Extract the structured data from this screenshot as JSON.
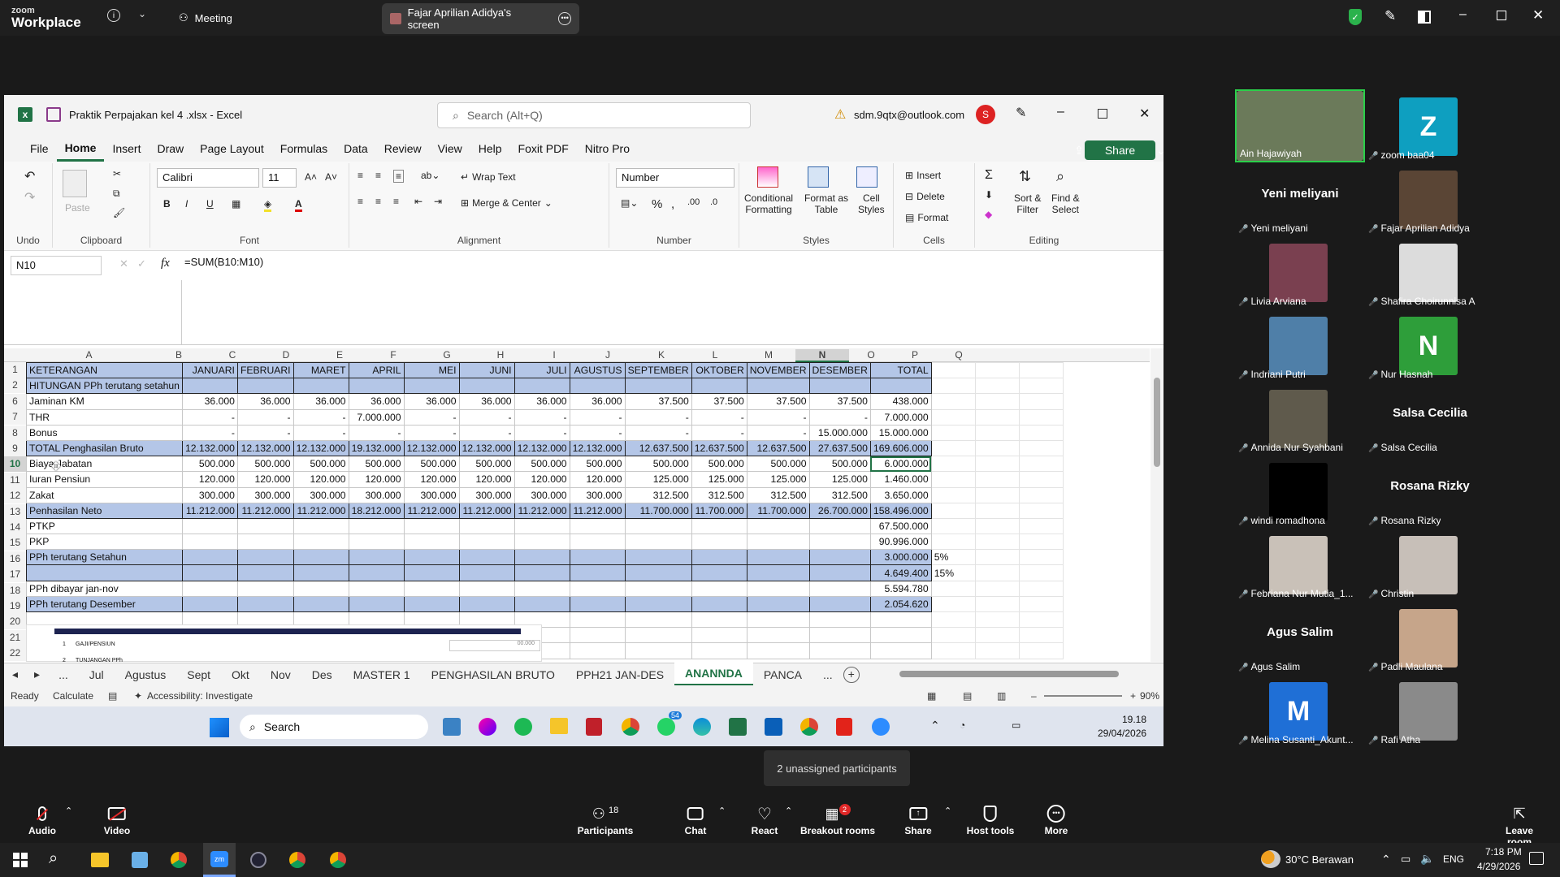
{
  "zoom": {
    "brand_top": "zoom",
    "brand_bottom": "Workplace",
    "tab_meeting": "Meeting",
    "tab_share": "Fajar Aprilian Adidya's screen"
  },
  "excel": {
    "title": "Praktik Perpajakan kel 4 .xlsx - Excel",
    "search_placeholder": "Search (Alt+Q)",
    "account": "sdm.9qtx@outlook.com",
    "avatar": "S",
    "menu": [
      "File",
      "Home",
      "Insert",
      "Draw",
      "Page Layout",
      "Formulas",
      "Data",
      "Review",
      "View",
      "Help",
      "Foxit PDF",
      "Nitro Pro"
    ],
    "share": "Share",
    "ribbon": {
      "undo": "Undo",
      "clipboard": "Clipboard",
      "paste": "Paste",
      "font": "Font",
      "font_name": "Calibri",
      "font_size": "11",
      "alignment": "Alignment",
      "wrap_text": "Wrap Text",
      "merge_center": "Merge & Center",
      "number": "Number",
      "number_format": "Number",
      "styles": "Styles",
      "cond_fmt_1": "Conditional",
      "cond_fmt_2": "Formatting",
      "fmt_table_1": "Format as",
      "fmt_table_2": "Table",
      "cell_styles_1": "Cell",
      "cell_styles_2": "Styles",
      "cells": "Cells",
      "insert": "Insert",
      "delete": "Delete",
      "format": "Format",
      "editing": "Editing",
      "sort_1": "Sort &",
      "sort_2": "Filter",
      "find_1": "Find &",
      "find_2": "Select"
    },
    "name_box": "N10",
    "formula": "=SUM(B10:M10)",
    "col_headers": [
      "A",
      "B",
      "C",
      "D",
      "E",
      "F",
      "G",
      "H",
      "I",
      "J",
      "K",
      "L",
      "M",
      "N",
      "O",
      "P",
      "Q"
    ],
    "row_numbers": [
      "1",
      "2",
      "6",
      "7",
      "8",
      "9",
      "10",
      "11",
      "12",
      "13",
      "14",
      "15",
      "16",
      "17",
      "18",
      "19",
      "20",
      "21",
      "22"
    ],
    "rows": [
      [
        "KETERANGAN",
        "JANUARI",
        "FEBRUARI",
        "MARET",
        "APRIL",
        "MEI",
        "JUNI",
        "JULI",
        "AGUSTUS",
        "SEPTEMBER",
        "OKTOBER",
        "NOVEMBER",
        "DESEMBER",
        "TOTAL",
        "",
        ""
      ],
      [
        "HITUNGAN PPh terutang setahun",
        "",
        "",
        "",
        "",
        "",
        "",
        "",
        "",
        "",
        "",
        "",
        "",
        "",
        "",
        ""
      ],
      [
        "Jaminan KM",
        "36.000",
        "36.000",
        "36.000",
        "36.000",
        "36.000",
        "36.000",
        "36.000",
        "36.000",
        "37.500",
        "37.500",
        "37.500",
        "37.500",
        "438.000",
        "",
        ""
      ],
      [
        "THR",
        "-",
        "-",
        "-",
        "7.000.000",
        "-",
        "-",
        "-",
        "-",
        "-",
        "-",
        "-",
        "-",
        "7.000.000",
        "",
        ""
      ],
      [
        "Bonus",
        "-",
        "-",
        "-",
        "-",
        "-",
        "-",
        "-",
        "-",
        "-",
        "-",
        "-",
        "15.000.000",
        "15.000.000",
        "",
        ""
      ],
      [
        "TOTAL Penghasilan Bruto",
        "12.132.000",
        "12.132.000",
        "12.132.000",
        "19.132.000",
        "12.132.000",
        "12.132.000",
        "12.132.000",
        "12.132.000",
        "12.637.500",
        "12.637.500",
        "12.637.500",
        "27.637.500",
        "169.606.000",
        "",
        ""
      ],
      [
        "Biaya Jabatan",
        "500.000",
        "500.000",
        "500.000",
        "500.000",
        "500.000",
        "500.000",
        "500.000",
        "500.000",
        "500.000",
        "500.000",
        "500.000",
        "500.000",
        "6.000.000",
        "",
        ""
      ],
      [
        "Iuran Pensiun",
        "120.000",
        "120.000",
        "120.000",
        "120.000",
        "120.000",
        "120.000",
        "120.000",
        "120.000",
        "125.000",
        "125.000",
        "125.000",
        "125.000",
        "1.460.000",
        "",
        ""
      ],
      [
        "Zakat",
        "300.000",
        "300.000",
        "300.000",
        "300.000",
        "300.000",
        "300.000",
        "300.000",
        "300.000",
        "312.500",
        "312.500",
        "312.500",
        "312.500",
        "3.650.000",
        "",
        ""
      ],
      [
        "Penhasilan Neto",
        "11.212.000",
        "11.212.000",
        "11.212.000",
        "18.212.000",
        "11.212.000",
        "11.212.000",
        "11.212.000",
        "11.212.000",
        "11.700.000",
        "11.700.000",
        "11.700.000",
        "26.700.000",
        "158.496.000",
        "",
        ""
      ],
      [
        "PTKP",
        "",
        "",
        "",
        "",
        "",
        "",
        "",
        "",
        "",
        "",
        "",
        "",
        "67.500.000",
        "",
        ""
      ],
      [
        "PKP",
        "",
        "",
        "",
        "",
        "",
        "",
        "",
        "",
        "",
        "",
        "",
        "",
        "90.996.000",
        "",
        ""
      ],
      [
        "PPh terutang Setahun",
        "",
        "",
        "",
        "",
        "",
        "",
        "",
        "",
        "",
        "",
        "",
        "",
        "3.000.000",
        "5%",
        ""
      ],
      [
        "",
        "",
        "",
        "",
        "",
        "",
        "",
        "",
        "",
        "",
        "",
        "",
        "",
        "4.649.400",
        "15%",
        ""
      ],
      [
        "PPh dibayar jan-nov",
        "",
        "",
        "",
        "",
        "",
        "",
        "",
        "",
        "",
        "",
        "",
        "",
        "5.594.780",
        "",
        ""
      ],
      [
        "PPh terutang Desember",
        "",
        "",
        "",
        "",
        "",
        "",
        "",
        "",
        "",
        "",
        "",
        "",
        "2.054.620",
        "",
        ""
      ]
    ],
    "embedded": {
      "line1": "1",
      "line1_text": "GAJI/PENSIUN",
      "line2": "2",
      "line2_text": "TUNJANGAN PPh",
      "amount": "00.000"
    },
    "sheet_tabs": [
      "...",
      "Jul",
      "Agustus",
      "Sept",
      "Okt",
      "Nov",
      "Des",
      "MASTER 1",
      "PENGHASILAN BRUTO",
      "PPH21 JAN-DES",
      "ANANNDA",
      "PANCA",
      "..."
    ],
    "status_ready": "Ready",
    "status_calc": "Calculate",
    "status_access": "Accessibility: Investigate",
    "zoom_level": "90%",
    "win_search": "Search",
    "win_time": "19.18",
    "win_date": "29/04/2026",
    "badge_count": "54"
  },
  "participants": [
    {
      "name": "Ain Hajawiyah",
      "initial": "",
      "bg": "#6b7a5a"
    },
    {
      "name": "zoom baa04",
      "initial": "Z",
      "bg": "#0e9fc0"
    },
    {
      "name": "Yeni meliyani",
      "label": "Yeni meliyani"
    },
    {
      "name": "Fajar Aprilian Adidya",
      "initial": "",
      "bg": "#5a4535"
    },
    {
      "name": "Livia Arviana",
      "initial": "",
      "bg": "#7a4050"
    },
    {
      "name": "Shafira Choirunnisa A",
      "initial": "",
      "bg": "#dcdcdc"
    },
    {
      "name": "Indriani Putri",
      "initial": "",
      "bg": "#4f7fa8"
    },
    {
      "name": "Nur Hasnah",
      "initial": "N",
      "bg": "#2e9e3a"
    },
    {
      "name": "Annida Nur Syahbani",
      "initial": "",
      "bg": "#5f5a4c"
    },
    {
      "name": "Salsa Cecilia",
      "label": "Salsa Cecilia"
    },
    {
      "name": "windi romadhona",
      "initial": "",
      "bg": "#000000"
    },
    {
      "name": "Rosana Rizky",
      "label": "Rosana Rizky"
    },
    {
      "name": "Febriana Nur Mutia_1...",
      "initial": "",
      "bg": "#c9c1b8"
    },
    {
      "name": "Christin",
      "initial": "",
      "bg": "#c7bfb8"
    },
    {
      "name": "Agus Salim",
      "label": "Agus Salim"
    },
    {
      "name": "Padli Maulana",
      "initial": "",
      "bg": "#c6a58a"
    },
    {
      "name": "Melina Susanti_Akunt...",
      "initial": "M",
      "bg": "#1f6fd6"
    },
    {
      "name": "Rafi Atha",
      "initial": "",
      "bg": "#8a8a8a"
    }
  ],
  "tooltip": "2 unassigned participants",
  "controls": {
    "audio": "Audio",
    "video": "Video",
    "participants": "Participants",
    "participants_count": "18",
    "chat": "Chat",
    "react": "React",
    "breakout": "Breakout rooms",
    "breakout_badge": "2",
    "share": "Share",
    "host_tools": "Host tools",
    "more": "More",
    "leave": "Leave room"
  },
  "taskbar": {
    "weather": "30°C Berawan",
    "lang": "ENG",
    "time": "7:18 PM",
    "date": "4/29/2026"
  },
  "colors": {
    "excel_green": "#217346",
    "header_blue": "#b4c6e7",
    "zoom_green": "#0e8a3e"
  }
}
